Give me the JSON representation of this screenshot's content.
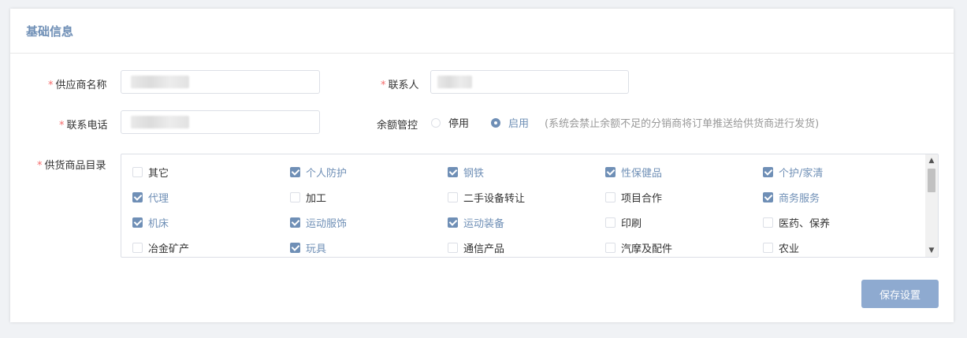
{
  "card": {
    "title": "基础信息"
  },
  "form": {
    "required_mark": "*",
    "supplier_name": {
      "label": "供应商名称",
      "value": ""
    },
    "contact_person": {
      "label": "联系人",
      "value": ""
    },
    "contact_phone": {
      "label": "联系电话",
      "value": ""
    },
    "balance_control": {
      "label": "余额管控",
      "options": [
        {
          "label": "停用",
          "checked": false
        },
        {
          "label": "启用",
          "checked": true
        }
      ],
      "hint": "(系统会禁止余额不足的分销商将订单推送给供货商进行发货)"
    },
    "catalog": {
      "label": "供货商品目录",
      "items": [
        {
          "label": "其它",
          "checked": false
        },
        {
          "label": "个人防护",
          "checked": true
        },
        {
          "label": "钢铁",
          "checked": true
        },
        {
          "label": "性保健品",
          "checked": true
        },
        {
          "label": "个护/家清",
          "checked": true
        },
        {
          "label": "代理",
          "checked": true
        },
        {
          "label": "加工",
          "checked": false
        },
        {
          "label": "二手设备转让",
          "checked": false
        },
        {
          "label": "项目合作",
          "checked": false
        },
        {
          "label": "商务服务",
          "checked": true
        },
        {
          "label": "机床",
          "checked": true
        },
        {
          "label": "运动服饰",
          "checked": true
        },
        {
          "label": "运动装备",
          "checked": true
        },
        {
          "label": "印刷",
          "checked": false
        },
        {
          "label": "医药、保养",
          "checked": false
        },
        {
          "label": "冶金矿产",
          "checked": false
        },
        {
          "label": "玩具",
          "checked": true
        },
        {
          "label": "通信产品",
          "checked": false
        },
        {
          "label": "汽摩及配件",
          "checked": false
        },
        {
          "label": "农业",
          "checked": false
        }
      ]
    }
  },
  "scroll": {
    "up_icon": "chevron-up-icon",
    "down_icon": "chevron-down-icon",
    "up_glyph": "▲",
    "down_glyph": "▼"
  },
  "actions": {
    "save_label": "保存设置"
  },
  "colors": {
    "accent": "#6f8fb6",
    "button": "#8eaad0",
    "required": "#f56c6c"
  }
}
